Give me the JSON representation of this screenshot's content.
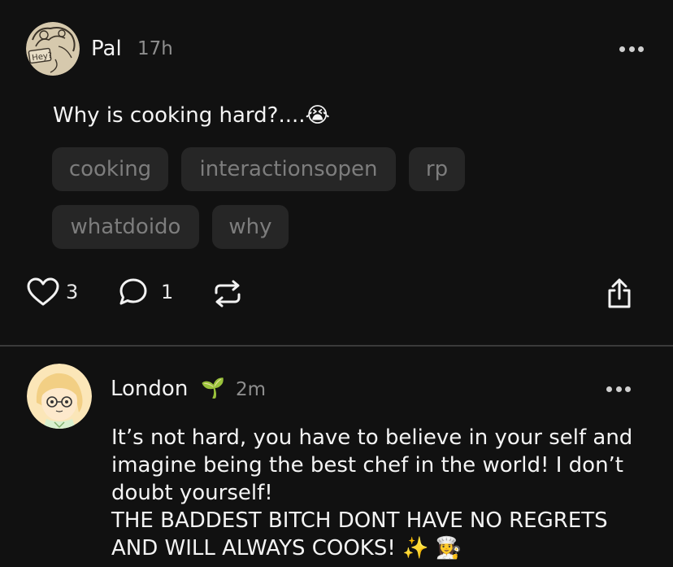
{
  "post": {
    "author": "Pal",
    "time": "17h",
    "text": "Why is cooking hard?....",
    "emoji": "😭",
    "tags": [
      "cooking",
      "interactionsopen",
      "rp",
      "whatdoido",
      "why"
    ],
    "likes": "3",
    "comments": "1",
    "avatar_text": "Hey?"
  },
  "reply": {
    "author": "London",
    "badge_emoji": "🌱",
    "time": "2m",
    "lines": [
      "It’s not hard, you have to believe in your self and",
      "imagine being the best chef in the world! I don’t",
      "doubt yourself!",
      "THE BADDEST BITCH DONT HAVE NO REGRETS",
      "AND WILL ALWAYS COOKS!"
    ],
    "trailing_emojis": "✨ 👩‍🍳"
  },
  "icons": {
    "like": "heart-icon",
    "comment": "comment-bubble-icon",
    "repost": "repost-icon",
    "share": "share-icon",
    "more": "more-dots-icon"
  }
}
